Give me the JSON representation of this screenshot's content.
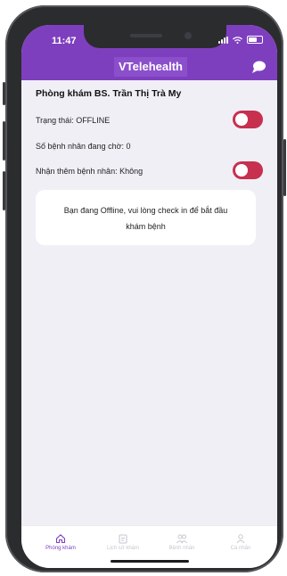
{
  "status_bar": {
    "time": "11:47"
  },
  "header": {
    "title": "VTelehealth",
    "chat_icon": "chat-bubble-icon"
  },
  "clinic": {
    "title": "Phòng khám BS. Trần Thị Trà My",
    "status_label": "Trạng thái: OFFLINE",
    "waiting_label": "Số bệnh nhân đang chờ: 0",
    "accept_label": "Nhận thêm bệnh nhân: Không",
    "status_toggle_on": false,
    "accept_toggle_on": false
  },
  "notice": {
    "text": "Bạn đang Offline, vui lòng check in để bắt đầu khám bệnh"
  },
  "tabs": [
    {
      "label": "Phòng khám",
      "icon": "home-icon",
      "active": true
    },
    {
      "label": "Lịch sử khám",
      "icon": "calendar-icon",
      "active": false
    },
    {
      "label": "Bệnh nhân",
      "icon": "patients-icon",
      "active": false
    },
    {
      "label": "Cá nhân",
      "icon": "profile-icon",
      "active": false
    }
  ],
  "colors": {
    "primary": "#7e3fbf",
    "toggle_off": "#c7304f",
    "background": "#f1eff6"
  }
}
